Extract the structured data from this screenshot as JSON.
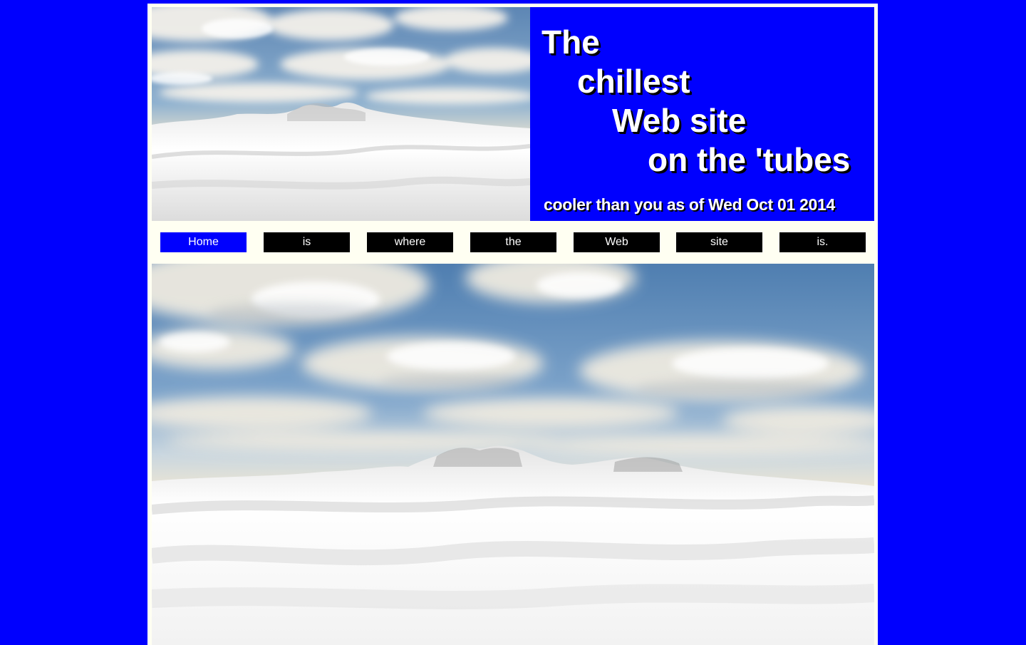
{
  "header": {
    "title_lines": [
      "The",
      "chillest",
      "Web site",
      "on the 'tubes"
    ],
    "tagline": "cooler than you as of Wed Oct 01 2014",
    "image": "snowy-landscape-with-clouds"
  },
  "nav": {
    "items": [
      {
        "label": "Home",
        "active": true
      },
      {
        "label": "is",
        "active": false
      },
      {
        "label": "where",
        "active": false
      },
      {
        "label": "the",
        "active": false
      },
      {
        "label": "Web",
        "active": false
      },
      {
        "label": "site",
        "active": false
      },
      {
        "label": "is.",
        "active": false
      }
    ]
  },
  "main": {
    "image": "snowy-landscape-with-clouds"
  },
  "colors": {
    "background": "#0000fe",
    "page": "#fffff2",
    "nav_inactive": "#000000",
    "nav_active": "#0000fe",
    "text": "#ffffff"
  }
}
